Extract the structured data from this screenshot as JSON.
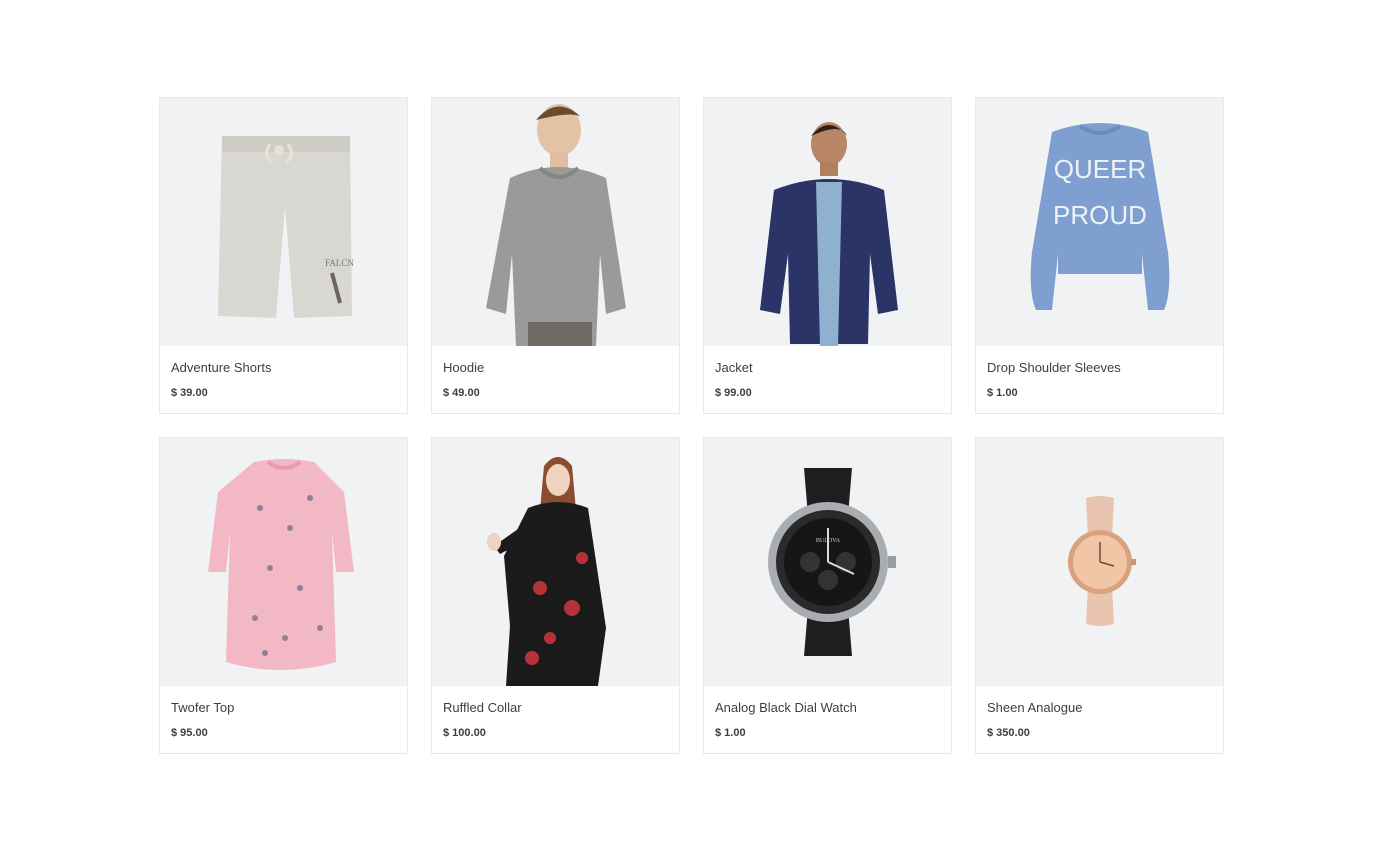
{
  "products": [
    {
      "name": "Adventure Shorts",
      "price": "$ 39.00",
      "image": "grey-shorts"
    },
    {
      "name": "Hoodie",
      "price": "$ 49.00",
      "image": "man-in-grey-hoodie"
    },
    {
      "name": "Jacket",
      "price": "$ 99.00",
      "image": "man-in-navy-jacket"
    },
    {
      "name": "Drop Shoulder Sleeves",
      "price": "$ 1.00",
      "image": "blue-sweatshirt",
      "image_text": [
        "QUEER",
        "PROUD"
      ]
    },
    {
      "name": "Twofer Top",
      "price": "$ 95.00",
      "image": "pink-printed-dress"
    },
    {
      "name": "Ruffled Collar",
      "price": "$ 100.00",
      "image": "woman-in-floral-dress"
    },
    {
      "name": "Analog Black Dial Watch",
      "price": "$ 1.00",
      "image": "black-chronograph-watch",
      "image_text": [
        "BULOVA"
      ]
    },
    {
      "name": "Sheen Analogue",
      "price": "$ 350.00",
      "image": "rose-gold-watch"
    }
  ],
  "colors": {
    "card_border": "#e6e8eb",
    "image_background": "#f1f2f4",
    "text": "#3b3f44"
  }
}
